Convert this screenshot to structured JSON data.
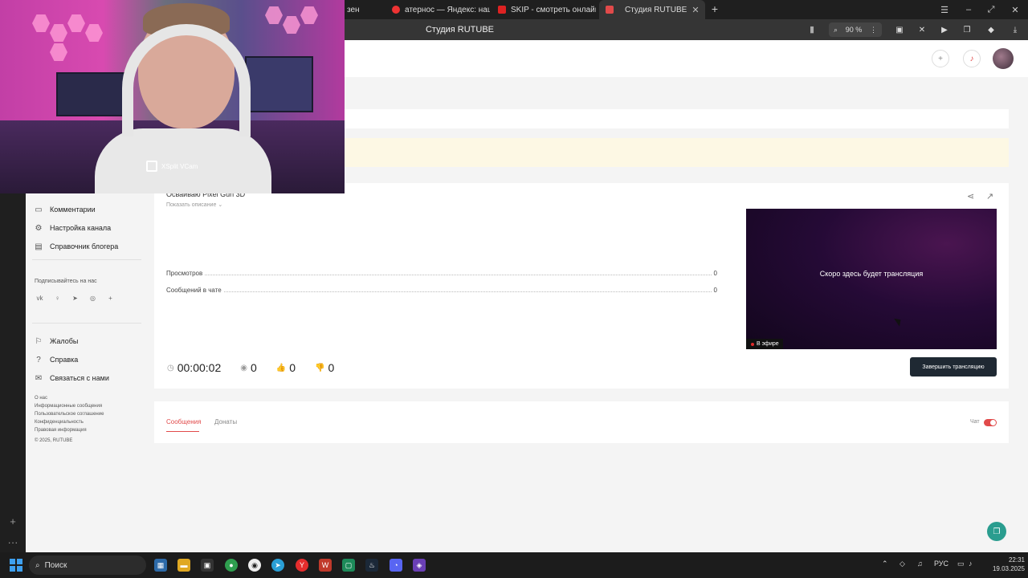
{
  "browser": {
    "tabs": [
      {
        "label": "зен",
        "active": false
      },
      {
        "label": "атернос — Яндекс: нашл",
        "active": false
      },
      {
        "label": "SKIP - смотреть онлайн в",
        "active": false
      },
      {
        "label": "Студия RUTUBE",
        "active": true
      }
    ],
    "new_tab": "+",
    "page_title": "Студия RUTUBE",
    "zoom": "90 %",
    "window_controls": [
      "☰",
      "–",
      "⤢",
      "✕"
    ]
  },
  "webcam": {
    "watermark": "XSplit VCam"
  },
  "sidebar": {
    "items": [
      {
        "label": "Комментарии",
        "icon": "comment-icon"
      },
      {
        "label": "Настройка канала",
        "icon": "gear-icon"
      },
      {
        "label": "Справочник блогера",
        "icon": "book-icon"
      }
    ],
    "subscribe_label": "Подписывайтесь на нас",
    "socials": [
      "vk",
      "ok",
      "telegram",
      "viber",
      "plus"
    ],
    "support_items": [
      {
        "label": "Жалобы",
        "icon": "flag-icon"
      },
      {
        "label": "Справка",
        "icon": "help-icon"
      },
      {
        "label": "Связаться с нами",
        "icon": "mail-icon"
      }
    ],
    "footer_links": [
      "О нас",
      "Информационные сообщения",
      "Пользовательское соглашение",
      "Конфиденциальность",
      "Правовая информация"
    ],
    "copyright": "© 2025, RUTUBE"
  },
  "stream": {
    "title": "Осваиваю Pixel Gun 3D",
    "show_description": "Показать описание",
    "stats": [
      {
        "label": "Просмотров",
        "value": "0"
      },
      {
        "label": "Сообщений в чате",
        "value": "0"
      }
    ],
    "preview_text": "Скоро здесь будет трансляция",
    "live_label": "В эфире",
    "timer": "00:00:02",
    "viewers": "0",
    "likes": "0",
    "dislikes": "0",
    "end_button": "Завершить трансляцию"
  },
  "chat": {
    "tabs": [
      "Сообщения",
      "Донаты"
    ],
    "toggle_label": "Чат",
    "toggle_on": true
  },
  "taskbar": {
    "search_placeholder": "Поиск",
    "language": "РУС",
    "time": "22:31",
    "date": "19.03.2025"
  },
  "colors": {
    "accent": "#e14a4a",
    "end_button_bg": "#1f2933",
    "preview_bg": "#250a36"
  }
}
